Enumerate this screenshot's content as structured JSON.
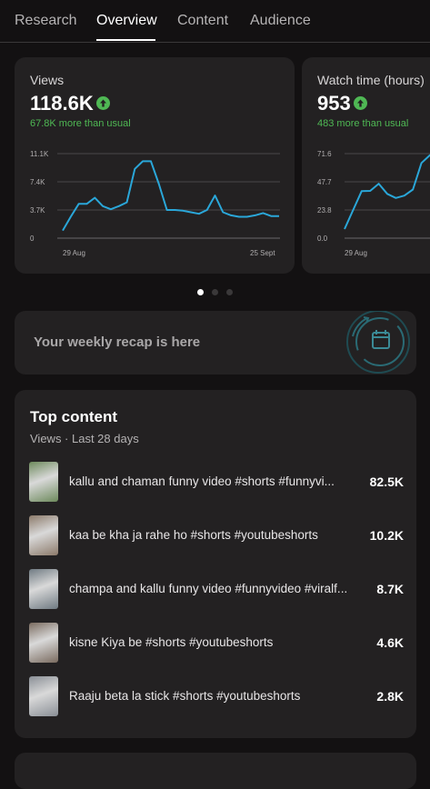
{
  "tabs": [
    {
      "label": "Research"
    },
    {
      "label": "Overview"
    },
    {
      "label": "Content"
    },
    {
      "label": "Audience"
    }
  ],
  "metrics": [
    {
      "title": "Views",
      "value": "118.6K",
      "delta": "67.8K more than usual",
      "y_ticks": [
        "11.1K",
        "7.4K",
        "3.7K",
        "0"
      ],
      "x_start": "29 Aug",
      "x_end": "25 Sept"
    },
    {
      "title": "Watch time (hours)",
      "value": "953",
      "delta": "483 more than usual",
      "y_ticks": [
        "71.6",
        "47.7",
        "23.8",
        "0.0"
      ],
      "x_start": "29 Aug",
      "x_end": ""
    }
  ],
  "chart_data": [
    {
      "type": "line",
      "title": "Views",
      "x_range": [
        "29 Aug",
        "25 Sept"
      ],
      "ylim": [
        0,
        11100
      ],
      "y_ticks": [
        "11.1K",
        "7.4K",
        "3.7K",
        "0"
      ],
      "values": [
        1000,
        2800,
        4500,
        4500,
        5300,
        4200,
        3800,
        4200,
        4700,
        9100,
        10100,
        10100,
        7100,
        3700,
        3700,
        3600,
        3400,
        3200,
        3700,
        5600,
        3400,
        3000,
        2800,
        2800,
        3000,
        3300,
        2900,
        2900
      ],
      "color": "#2aa7d9",
      "grid": true
    },
    {
      "type": "line",
      "title": "Watch time (hours)",
      "x_range": [
        "29 Aug",
        ""
      ],
      "ylim": [
        0,
        71.6
      ],
      "y_ticks": [
        "71.6",
        "47.7",
        "23.8",
        "0.0"
      ],
      "values": [
        7.7,
        23.8,
        39.8,
        40.0,
        46.1,
        37.5,
        34.0,
        36.0,
        41.2,
        63.7,
        70.4,
        70.4
      ],
      "color": "#2aa7d9",
      "grid": true
    }
  ],
  "pager": {
    "count": 3,
    "active": 0
  },
  "recap": {
    "text": "Your weekly recap is here",
    "icon": "calendar-refresh-icon"
  },
  "top_content": {
    "title": "Top content",
    "subtitle": "Views · Last 28 days",
    "items": [
      {
        "title": "kallu and chaman funny video #shorts #funnyvi...",
        "value": "82.5K",
        "thumb_color": "#6d8a5c"
      },
      {
        "title": "kaa be kha ja rahe ho #shorts #youtubeshorts",
        "value": "10.2K",
        "thumb_color": "#8c7a6a"
      },
      {
        "title": "champa and kallu funny video #funnyvideo #viralf...",
        "value": "8.7K",
        "thumb_color": "#6f7a82"
      },
      {
        "title": "kisne Kiya be #shorts #youtubeshorts",
        "value": "4.6K",
        "thumb_color": "#7a6b5f"
      },
      {
        "title": "Raaju beta la stick #shorts #youtubeshorts",
        "value": "2.8K",
        "thumb_color": "#8a8f96"
      }
    ]
  },
  "colors": {
    "accent_line": "#2aa7d9",
    "positive": "#4fb854",
    "card_bg": "#232122",
    "page_bg": "#131112"
  }
}
